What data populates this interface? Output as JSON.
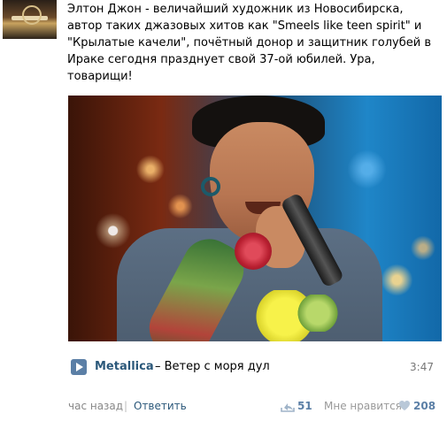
{
  "post": {
    "text": "Элтон Джон - величайший художник из Новосибирска,\nавтор таких джазовых хитов как \"Smeels like teen spirit\" и\n\"Крылатые качели\", почётный донор и защитник голубей в\nИраке сегодня празднует свой 37-ой юбилей. Ура,\nтоварищи!"
  },
  "audio": {
    "artist": "Metallica",
    "title": "– Ветер с моря дул",
    "duration": "3:47"
  },
  "footer": {
    "time": "час назад",
    "separator": "|",
    "reply": "Ответить",
    "shares": "51",
    "like_label": "Мне нравится",
    "likes": "208"
  },
  "colors": {
    "link": "#2b587a",
    "accent": "#5b7fa6",
    "muted": "#888888"
  }
}
